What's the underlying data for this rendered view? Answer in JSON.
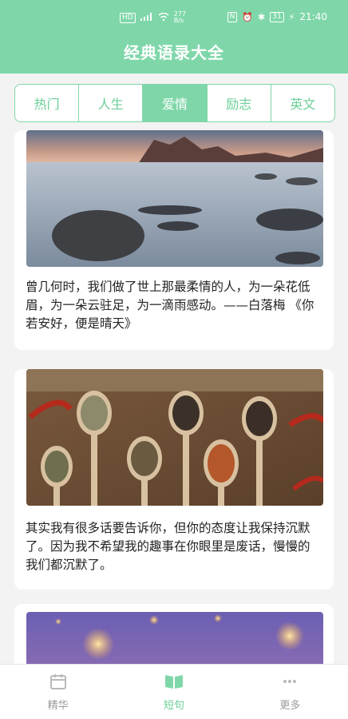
{
  "statusbar": {
    "net_speed": "277\nB/s",
    "battery": "31",
    "time": "21:40"
  },
  "header": {
    "title": "经典语录大全"
  },
  "tabs": [
    {
      "label": "热门",
      "active": false
    },
    {
      "label": "人生",
      "active": false
    },
    {
      "label": "爱情",
      "active": true
    },
    {
      "label": "励志",
      "active": false
    },
    {
      "label": "英文",
      "active": false
    }
  ],
  "cards": [
    {
      "text": "曾几何时，我们做了世上那最柔情的人，为一朵花低眉，为一朵云驻足，为一滴雨感动。——白落梅 《你若安好，便是晴天》"
    },
    {
      "text": "其实我有很多话要告诉你，但你的态度让我保持沉默了。因为我不希望我的趣事在你眼里是废话，慢慢的我们都沉默了。"
    }
  ],
  "bottom_nav": [
    {
      "label": "精华",
      "icon": "calendar-icon",
      "active": false
    },
    {
      "label": "短句",
      "icon": "book-icon",
      "active": true
    },
    {
      "label": "更多",
      "icon": "more-dots-icon",
      "active": false
    }
  ],
  "colors": {
    "accent": "#7fd7a9",
    "accent_text": "#6bcf98"
  }
}
